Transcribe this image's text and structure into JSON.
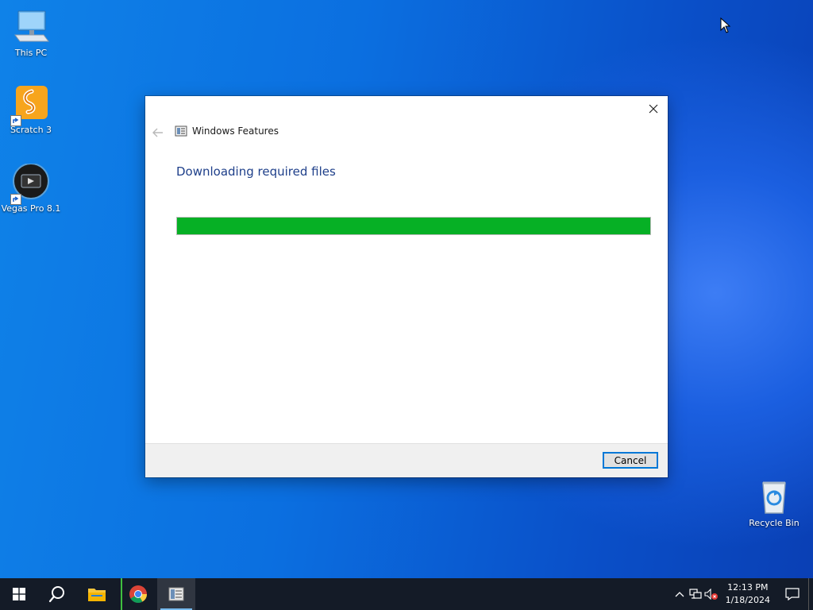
{
  "desktop": {
    "icons": [
      {
        "label": "This PC"
      },
      {
        "label": "Scratch 3"
      },
      {
        "label": "Vegas Pro 8.1"
      },
      {
        "label": "Recycle Bin"
      }
    ]
  },
  "dialog": {
    "title": "Windows Features",
    "heading": "Downloading required files",
    "progress": 1.0,
    "progress_color": "#06b025",
    "cancel_label": "Cancel"
  },
  "taskbar": {
    "buttons": [
      {
        "icon": "windows-start-icon"
      },
      {
        "icon": "search-icon"
      },
      {
        "icon": "file-explorer-icon"
      },
      {
        "icon": "chrome-icon"
      },
      {
        "icon": "windows-features-icon"
      }
    ],
    "tray": {
      "icons": [
        "chevron-up-icon",
        "network-icon",
        "volume-muted-icon"
      ],
      "time": "12:13 PM",
      "date": "1/18/2024"
    }
  }
}
